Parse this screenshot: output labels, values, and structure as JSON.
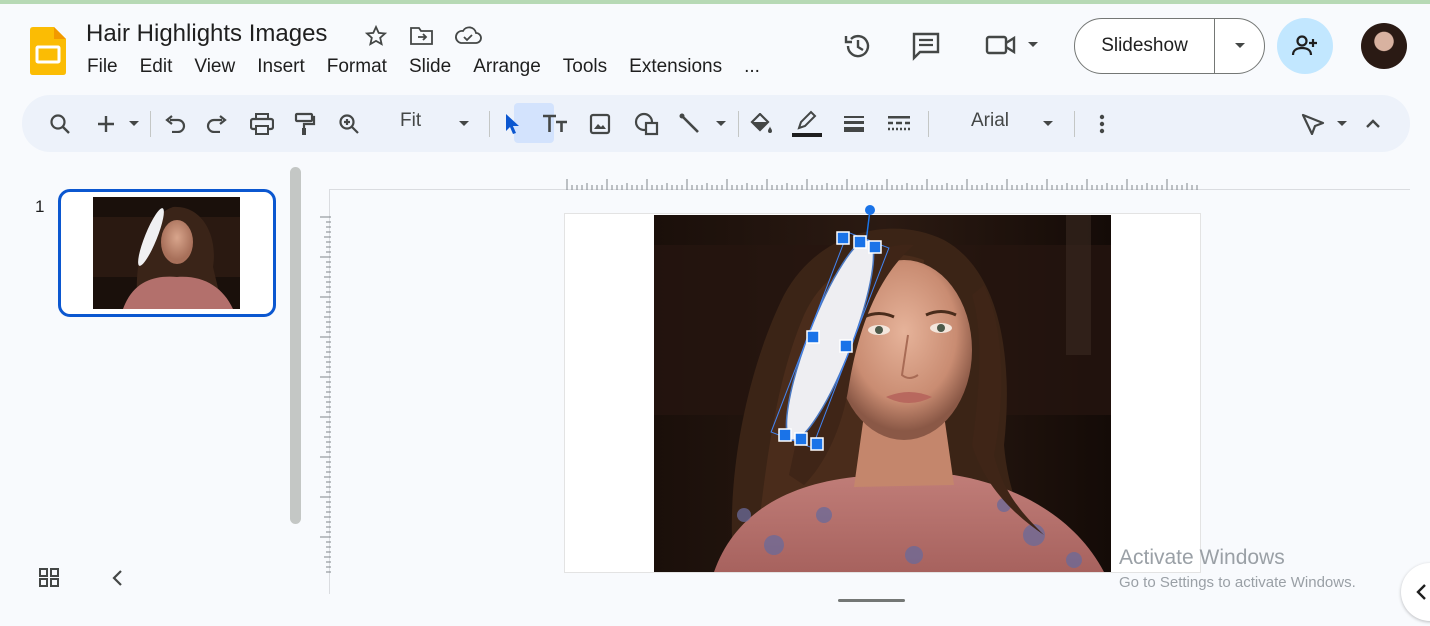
{
  "app": {
    "doc_title": "Hair Highlights Images",
    "menu": [
      "File",
      "Edit",
      "View",
      "Insert",
      "Format",
      "Slide",
      "Arrange",
      "Tools",
      "Extensions",
      "..."
    ]
  },
  "header": {
    "slideshow_label": "Slideshow"
  },
  "toolbar": {
    "zoom_label": "Fit",
    "font_label": "Arial"
  },
  "filmstrip": {
    "slide_number": "1"
  },
  "watermark": {
    "line1": "Activate Windows",
    "line2": "Go to Settings to activate Windows."
  },
  "colors": {
    "accent": "#0b57d0",
    "share_bg": "#c2e7ff",
    "toolbar_bg": "#edf2fa",
    "logo_yellow": "#fbbc04"
  },
  "icons": [
    "slides-logo-icon",
    "star-icon",
    "move-folder-icon",
    "cloud-saved-icon",
    "history-icon",
    "comment-icon",
    "meet-camera-icon",
    "share-icon",
    "search-icon",
    "add-icon",
    "undo-icon",
    "redo-icon",
    "print-icon",
    "paint-format-icon",
    "zoom-icon",
    "select-cursor-icon",
    "text-box-icon",
    "image-icon",
    "shape-icon",
    "line-icon",
    "fill-color-icon",
    "border-color-icon",
    "border-weight-icon",
    "border-dash-icon",
    "more-icon",
    "pen-tool-icon",
    "collapse-toolbar-icon",
    "grid-view-icon",
    "collapse-filmstrip-icon"
  ]
}
